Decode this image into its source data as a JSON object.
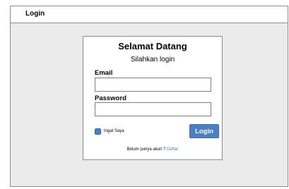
{
  "header": {
    "title": "Login"
  },
  "login_card": {
    "title": "Selamat Datang",
    "subtitle": "Silahkan login",
    "email_label": "Email",
    "email_value": "",
    "password_label": "Password",
    "password_value": "",
    "remember_label": "Ingat Saya",
    "remember_checked": true,
    "login_button_label": "Login",
    "register_prompt": "Belum punya akun ?",
    "register_link_label": "Daftar"
  },
  "colors": {
    "accent": "#4a7fc4",
    "background": "#ebebeb",
    "border": "#8c8c8c"
  }
}
